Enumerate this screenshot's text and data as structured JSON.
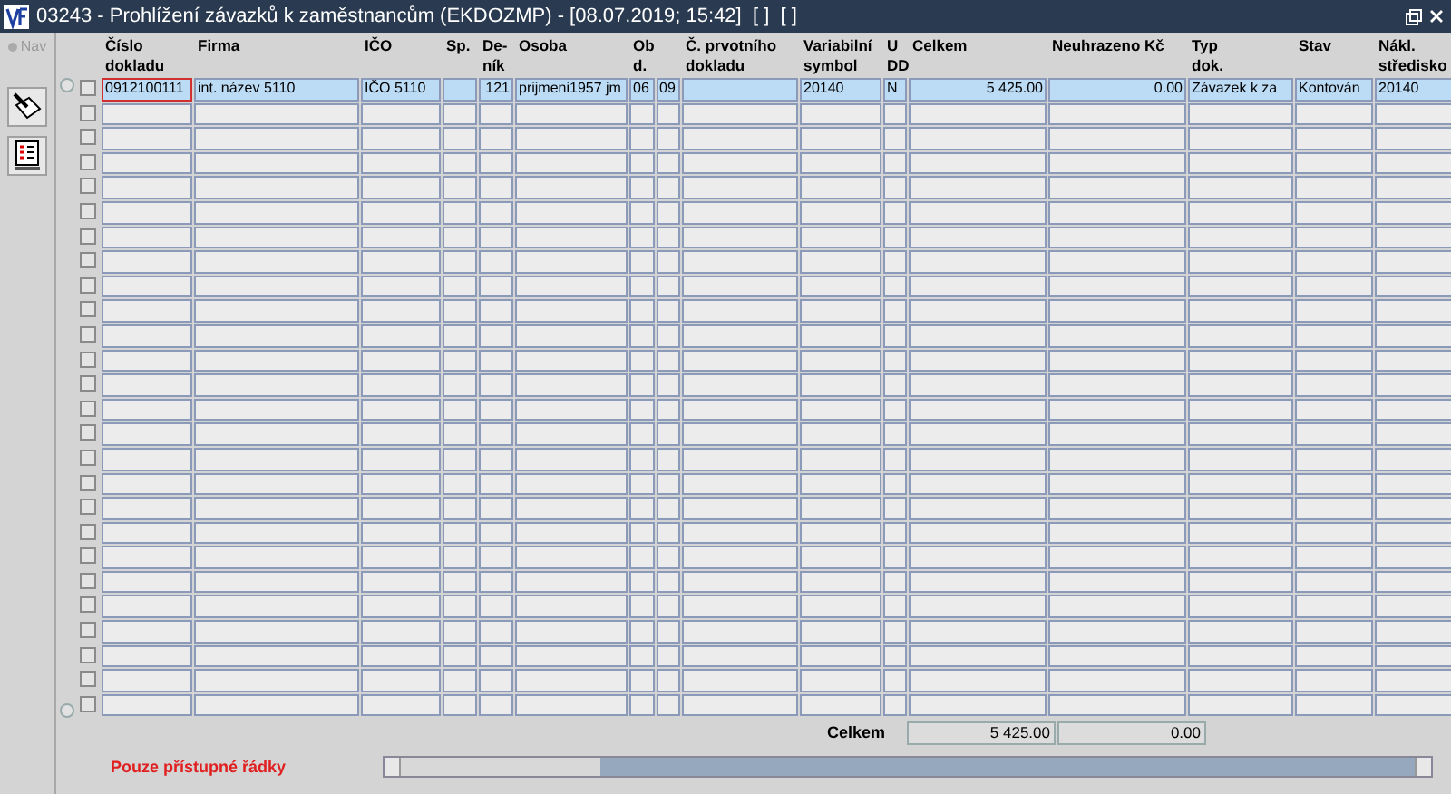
{
  "window": {
    "title": "03243 - Prohlížení závazků k zaměstnancům (EKDOZMP) - [08.07.2019; 15:42]  [ ]  [ ]"
  },
  "toolbar": {
    "nav_label": "Nav"
  },
  "table": {
    "columns": [
      {
        "label": "Číslo\ndokladu",
        "kind": "text"
      },
      {
        "label": "Firma",
        "kind": "text"
      },
      {
        "label": "IČO",
        "kind": "text"
      },
      {
        "label": "Sp.",
        "kind": "text"
      },
      {
        "label": "De-\nník",
        "kind": "number"
      },
      {
        "label": "Osoba",
        "kind": "text"
      },
      {
        "label": "Ob\nd.",
        "kind": "pair"
      },
      {
        "label": "Č. prvotního\ndokladu",
        "kind": "text"
      },
      {
        "label": "Variabilní\nsymbol",
        "kind": "text"
      },
      {
        "label": "U\nDD",
        "kind": "text"
      },
      {
        "label": "Celkem",
        "kind": "number"
      },
      {
        "label": "Neuhrazeno Kč",
        "kind": "number"
      },
      {
        "label": "Typ\ndok.",
        "kind": "text"
      },
      {
        "label": "Stav",
        "kind": "text"
      },
      {
        "label": "Nákl.\nstředisko",
        "kind": "text"
      }
    ],
    "rows": [
      {
        "checked": false,
        "selected": true,
        "cells": [
          {
            "text": "0912100111",
            "focused": true
          },
          "int. název 5110",
          "IČO 5110",
          "",
          "121",
          "prijmeni1957 jm",
          [
            "06",
            "09"
          ],
          "",
          "20140",
          "N",
          "5 425.00",
          "0.00",
          "Závazek k za",
          "Kontován",
          "20140"
        ]
      },
      {
        "checked": false,
        "selected": false
      },
      {
        "checked": false,
        "selected": false
      },
      {
        "checked": false,
        "selected": false
      },
      {
        "checked": false,
        "selected": false
      },
      {
        "checked": false,
        "selected": false
      },
      {
        "checked": false,
        "selected": false
      },
      {
        "checked": false,
        "selected": false
      },
      {
        "checked": false,
        "selected": false
      },
      {
        "checked": false,
        "selected": false
      },
      {
        "checked": false,
        "selected": false
      },
      {
        "checked": false,
        "selected": false
      },
      {
        "checked": false,
        "selected": false
      },
      {
        "checked": false,
        "selected": false
      },
      {
        "checked": false,
        "selected": false
      },
      {
        "checked": false,
        "selected": false
      },
      {
        "checked": false,
        "selected": false
      },
      {
        "checked": false,
        "selected": false
      },
      {
        "checked": false,
        "selected": false
      },
      {
        "checked": false,
        "selected": false
      },
      {
        "checked": false,
        "selected": false
      },
      {
        "checked": false,
        "selected": false
      },
      {
        "checked": false,
        "selected": false
      },
      {
        "checked": false,
        "selected": false
      },
      {
        "checked": false,
        "selected": false
      },
      {
        "checked": false,
        "selected": false
      }
    ],
    "totals": {
      "label": "Celkem",
      "celkem": "5 425.00",
      "neuhrazeno": "0.00"
    }
  },
  "status": {
    "message": "Pouze přístupné řádky"
  }
}
